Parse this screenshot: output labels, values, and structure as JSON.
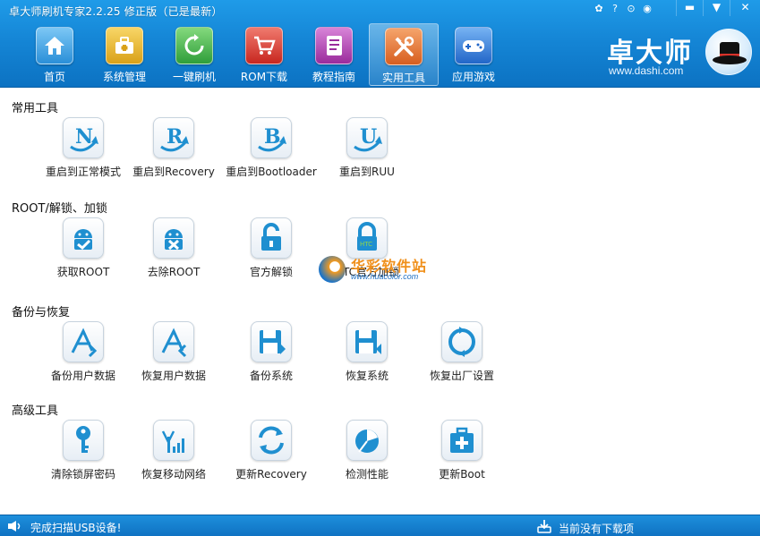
{
  "window": {
    "title": "卓大师刷机专家2.2.25 修正版（已是最新）",
    "minimize": "▬",
    "menu": "▼",
    "close": "✕"
  },
  "nav": [
    {
      "label": "首页",
      "icon": "home-icon",
      "color": "#3aa5e8"
    },
    {
      "label": "系统管理",
      "icon": "toolbox-icon",
      "color": "#e8b41c"
    },
    {
      "label": "一键刷机",
      "icon": "refresh-icon",
      "color": "#3fb24a"
    },
    {
      "label": "ROM下载",
      "icon": "cart-icon",
      "color": "#d9342b"
    },
    {
      "label": "教程指南",
      "icon": "book-icon",
      "color": "#b43bb5"
    },
    {
      "label": "实用工具",
      "icon": "tools-icon",
      "color": "#e2742c",
      "active": true
    },
    {
      "label": "应用游戏",
      "icon": "gamepad-icon",
      "color": "#2c78d8"
    }
  ],
  "logo": {
    "text": "卓大师",
    "url": "www.dashi.com"
  },
  "sections": [
    {
      "title": "常用工具",
      "tools": [
        "重启到正常模式",
        "重启到Recovery",
        "重启到Bootloader",
        "重启到RUU"
      ]
    },
    {
      "title": "ROOT/解锁、加锁",
      "tools": [
        "获取ROOT",
        "去除ROOT",
        "官方解锁",
        "HTC官方加锁"
      ]
    },
    {
      "title": "备份与恢复",
      "tools": [
        "备份用户数据",
        "恢复用户数据",
        "备份系统",
        "恢复系统",
        "恢复出厂设置"
      ]
    },
    {
      "title": "高级工具",
      "tools": [
        "清除锁屏密码",
        "恢复移动网络",
        "更新Recovery",
        "检测性能",
        "更新Boot"
      ]
    }
  ],
  "watermark": {
    "text": "华彩软件站",
    "url": "www.huacolor.com"
  },
  "status": {
    "left": "完成扫描USB设备!",
    "right": "当前没有下载项"
  },
  "colors": {
    "primary": "#1586d6",
    "icon": "#1f8fd0"
  }
}
